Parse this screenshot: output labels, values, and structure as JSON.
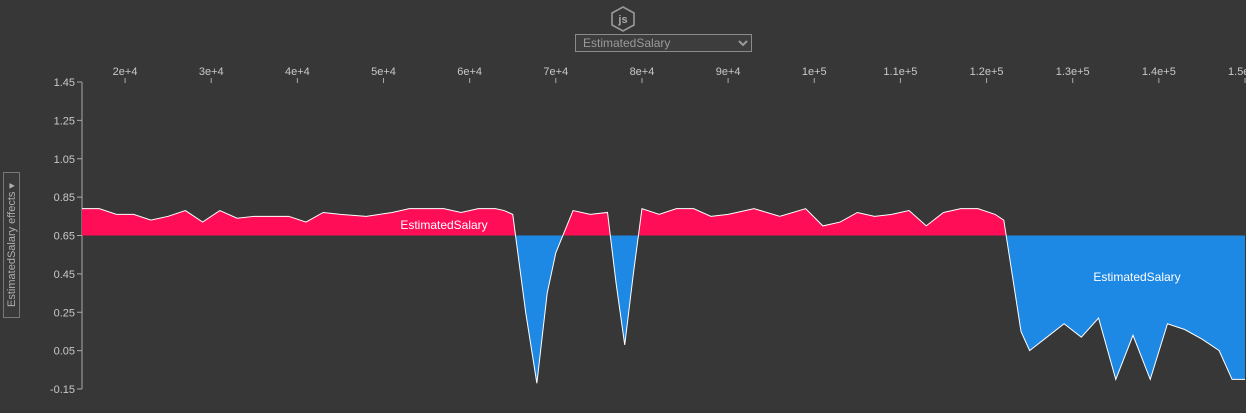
{
  "header": {
    "logo_icon": "js-hexagon-icon",
    "logo_text": "js",
    "feature_select": {
      "selected": "EstimatedSalary",
      "options": [
        "EstimatedSalary"
      ]
    }
  },
  "side_panel": {
    "label": "EstimatedSalary effects ▾"
  },
  "colors": {
    "background": "#373737",
    "positive": "#ff0d57",
    "negative": "#1e88e5",
    "axis": "#aaaaaa"
  },
  "chart_data": {
    "type": "area",
    "base_value": 0.65,
    "xlim": [
      15000,
      150000
    ],
    "ylim": [
      -0.15,
      1.45
    ],
    "x_ticks": [
      {
        "value": 20000,
        "label": "2e+4"
      },
      {
        "value": 30000,
        "label": "3e+4"
      },
      {
        "value": 40000,
        "label": "4e+4"
      },
      {
        "value": 50000,
        "label": "5e+4"
      },
      {
        "value": 60000,
        "label": "6e+4"
      },
      {
        "value": 70000,
        "label": "7e+4"
      },
      {
        "value": 80000,
        "label": "8e+4"
      },
      {
        "value": 90000,
        "label": "9e+4"
      },
      {
        "value": 100000,
        "label": "1e+5"
      },
      {
        "value": 110000,
        "label": "1.1e+5"
      },
      {
        "value": 120000,
        "label": "1.2e+5"
      },
      {
        "value": 130000,
        "label": "1.3e+5"
      },
      {
        "value": 140000,
        "label": "1.4e+5"
      },
      {
        "value": 150000,
        "label": "1.5e+5"
      }
    ],
    "y_ticks": [
      1.45,
      1.25,
      1.05,
      0.85,
      0.65,
      0.45,
      0.25,
      0.05,
      -0.15
    ],
    "y_tick_labels": [
      "1.45",
      "1.25",
      "1.05",
      "0.85",
      "0.65",
      "0.45",
      "0.25",
      "0.05",
      "-0.15"
    ],
    "series_label": "EstimatedSalary",
    "points": [
      {
        "x": 15000,
        "y": 0.79
      },
      {
        "x": 17000,
        "y": 0.79
      },
      {
        "x": 19000,
        "y": 0.76
      },
      {
        "x": 21000,
        "y": 0.76
      },
      {
        "x": 23000,
        "y": 0.73
      },
      {
        "x": 25000,
        "y": 0.75
      },
      {
        "x": 27000,
        "y": 0.78
      },
      {
        "x": 29000,
        "y": 0.72
      },
      {
        "x": 31000,
        "y": 0.78
      },
      {
        "x": 33000,
        "y": 0.74
      },
      {
        "x": 35000,
        "y": 0.75
      },
      {
        "x": 39000,
        "y": 0.75
      },
      {
        "x": 41000,
        "y": 0.72
      },
      {
        "x": 43000,
        "y": 0.77
      },
      {
        "x": 45000,
        "y": 0.76
      },
      {
        "x": 48000,
        "y": 0.75
      },
      {
        "x": 51000,
        "y": 0.77
      },
      {
        "x": 53000,
        "y": 0.79
      },
      {
        "x": 57000,
        "y": 0.79
      },
      {
        "x": 59000,
        "y": 0.77
      },
      {
        "x": 61000,
        "y": 0.79
      },
      {
        "x": 63000,
        "y": 0.79
      },
      {
        "x": 64000,
        "y": 0.78
      },
      {
        "x": 65000,
        "y": 0.76
      },
      {
        "x": 66500,
        "y": 0.25
      },
      {
        "x": 67800,
        "y": -0.12
      },
      {
        "x": 69000,
        "y": 0.35
      },
      {
        "x": 70000,
        "y": 0.56
      },
      {
        "x": 72000,
        "y": 0.78
      },
      {
        "x": 74000,
        "y": 0.76
      },
      {
        "x": 76000,
        "y": 0.77
      },
      {
        "x": 77000,
        "y": 0.4
      },
      {
        "x": 78000,
        "y": 0.08
      },
      {
        "x": 79000,
        "y": 0.45
      },
      {
        "x": 80000,
        "y": 0.79
      },
      {
        "x": 82000,
        "y": 0.76
      },
      {
        "x": 84000,
        "y": 0.79
      },
      {
        "x": 86000,
        "y": 0.79
      },
      {
        "x": 88000,
        "y": 0.75
      },
      {
        "x": 90000,
        "y": 0.76
      },
      {
        "x": 93000,
        "y": 0.79
      },
      {
        "x": 96000,
        "y": 0.75
      },
      {
        "x": 99000,
        "y": 0.79
      },
      {
        "x": 101000,
        "y": 0.7
      },
      {
        "x": 103000,
        "y": 0.72
      },
      {
        "x": 105000,
        "y": 0.77
      },
      {
        "x": 107000,
        "y": 0.75
      },
      {
        "x": 109000,
        "y": 0.76
      },
      {
        "x": 111000,
        "y": 0.78
      },
      {
        "x": 113000,
        "y": 0.7
      },
      {
        "x": 115000,
        "y": 0.77
      },
      {
        "x": 117000,
        "y": 0.79
      },
      {
        "x": 119000,
        "y": 0.79
      },
      {
        "x": 121000,
        "y": 0.76
      },
      {
        "x": 122000,
        "y": 0.73
      },
      {
        "x": 124000,
        "y": 0.15
      },
      {
        "x": 125000,
        "y": 0.05
      },
      {
        "x": 127000,
        "y": 0.12
      },
      {
        "x": 129000,
        "y": 0.19
      },
      {
        "x": 131000,
        "y": 0.12
      },
      {
        "x": 133000,
        "y": 0.22
      },
      {
        "x": 135000,
        "y": -0.1
      },
      {
        "x": 137000,
        "y": 0.13
      },
      {
        "x": 139000,
        "y": -0.1
      },
      {
        "x": 141000,
        "y": 0.19
      },
      {
        "x": 143000,
        "y": 0.16
      },
      {
        "x": 145000,
        "y": 0.11
      },
      {
        "x": 147000,
        "y": 0.05
      },
      {
        "x": 148500,
        "y": -0.1
      },
      {
        "x": 150000,
        "y": -0.1
      }
    ],
    "grid": false
  }
}
